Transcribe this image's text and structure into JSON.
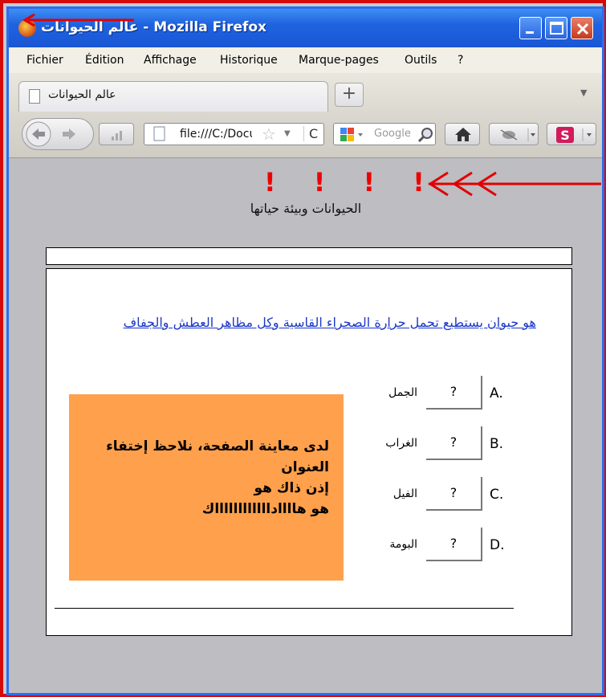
{
  "window": {
    "title": "عالم الحيوانات - Mozilla Firefox"
  },
  "menu": {
    "items": [
      "Fichier",
      "Édition",
      "Affichage",
      "Historique",
      "Marque-pages",
      "Outils",
      "?"
    ]
  },
  "tab": {
    "label": "عالم الحيوانات",
    "new_tab_symbol": "+"
  },
  "navbar": {
    "url": "file:///C:/Docu",
    "search_placeholder": "Google"
  },
  "page": {
    "exclamations": "! ! ! !",
    "subtitle": "الحيوانات وبيئة حياتها",
    "question": "هو حيوان يستطيع تحمل حرارة الصحراء القاسية وكل مظاهر العطش والجفاف",
    "options": [
      {
        "letter": "A.",
        "box": "?",
        "name": "الجمل"
      },
      {
        "letter": "B.",
        "box": "?",
        "name": "الغراب"
      },
      {
        "letter": "C.",
        "box": "?",
        "name": "الفيل"
      },
      {
        "letter": "D.",
        "box": "?",
        "name": "البومة"
      }
    ],
    "note_lines": [
      "لدى معاينة الصفحة، نلاحظ إختفاء",
      "العنوان",
      "إذن   ذاك هو",
      "هو  هاااادااااااااااااك"
    ]
  },
  "colors": {
    "annotation_red": "#e00000",
    "note_background": "#ffa04c",
    "link_blue": "#1a37c8"
  }
}
